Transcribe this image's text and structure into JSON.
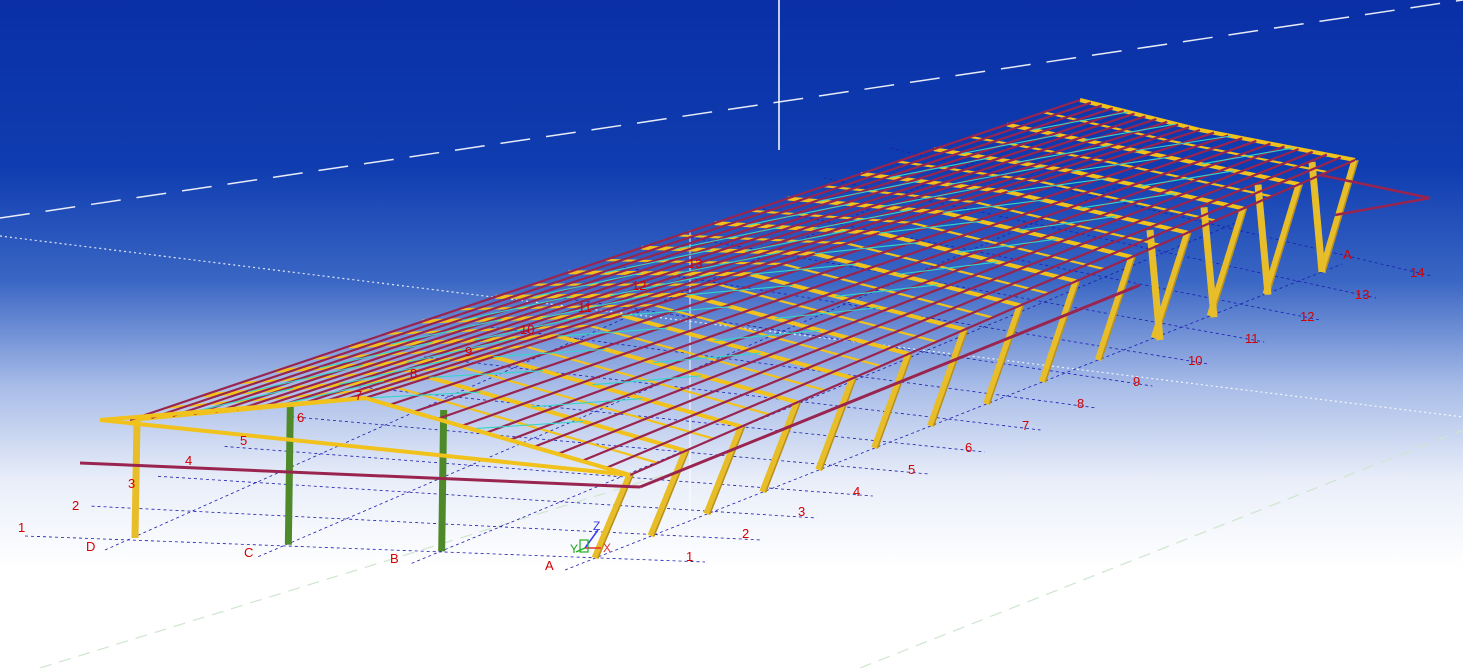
{
  "grid": {
    "rows_left": [
      "1",
      "2",
      "3",
      "4",
      "5",
      "6",
      "7",
      "8",
      "9",
      "10",
      "11",
      "12",
      "13"
    ],
    "rows_right": [
      "1",
      "2",
      "3",
      "4",
      "5",
      "6",
      "7",
      "8",
      "9",
      "10",
      "11",
      "12",
      "13",
      "14"
    ],
    "cols_front": [
      "D",
      "C",
      "B",
      "A"
    ],
    "col_right_end": "A"
  },
  "axes": {
    "x": "X",
    "y": "Y",
    "z": "Z"
  },
  "colors": {
    "bg_top": "#0a2fa6",
    "bg_bottom": "#ffffff",
    "grid_label": "#d40000",
    "grid_line": "#1b1bb0",
    "purlin": "#9a2450",
    "rafter": "#f1c21b",
    "bracing": "#33d6c8",
    "column": "#e7bd2a",
    "column_green": "#4f8a2a"
  }
}
